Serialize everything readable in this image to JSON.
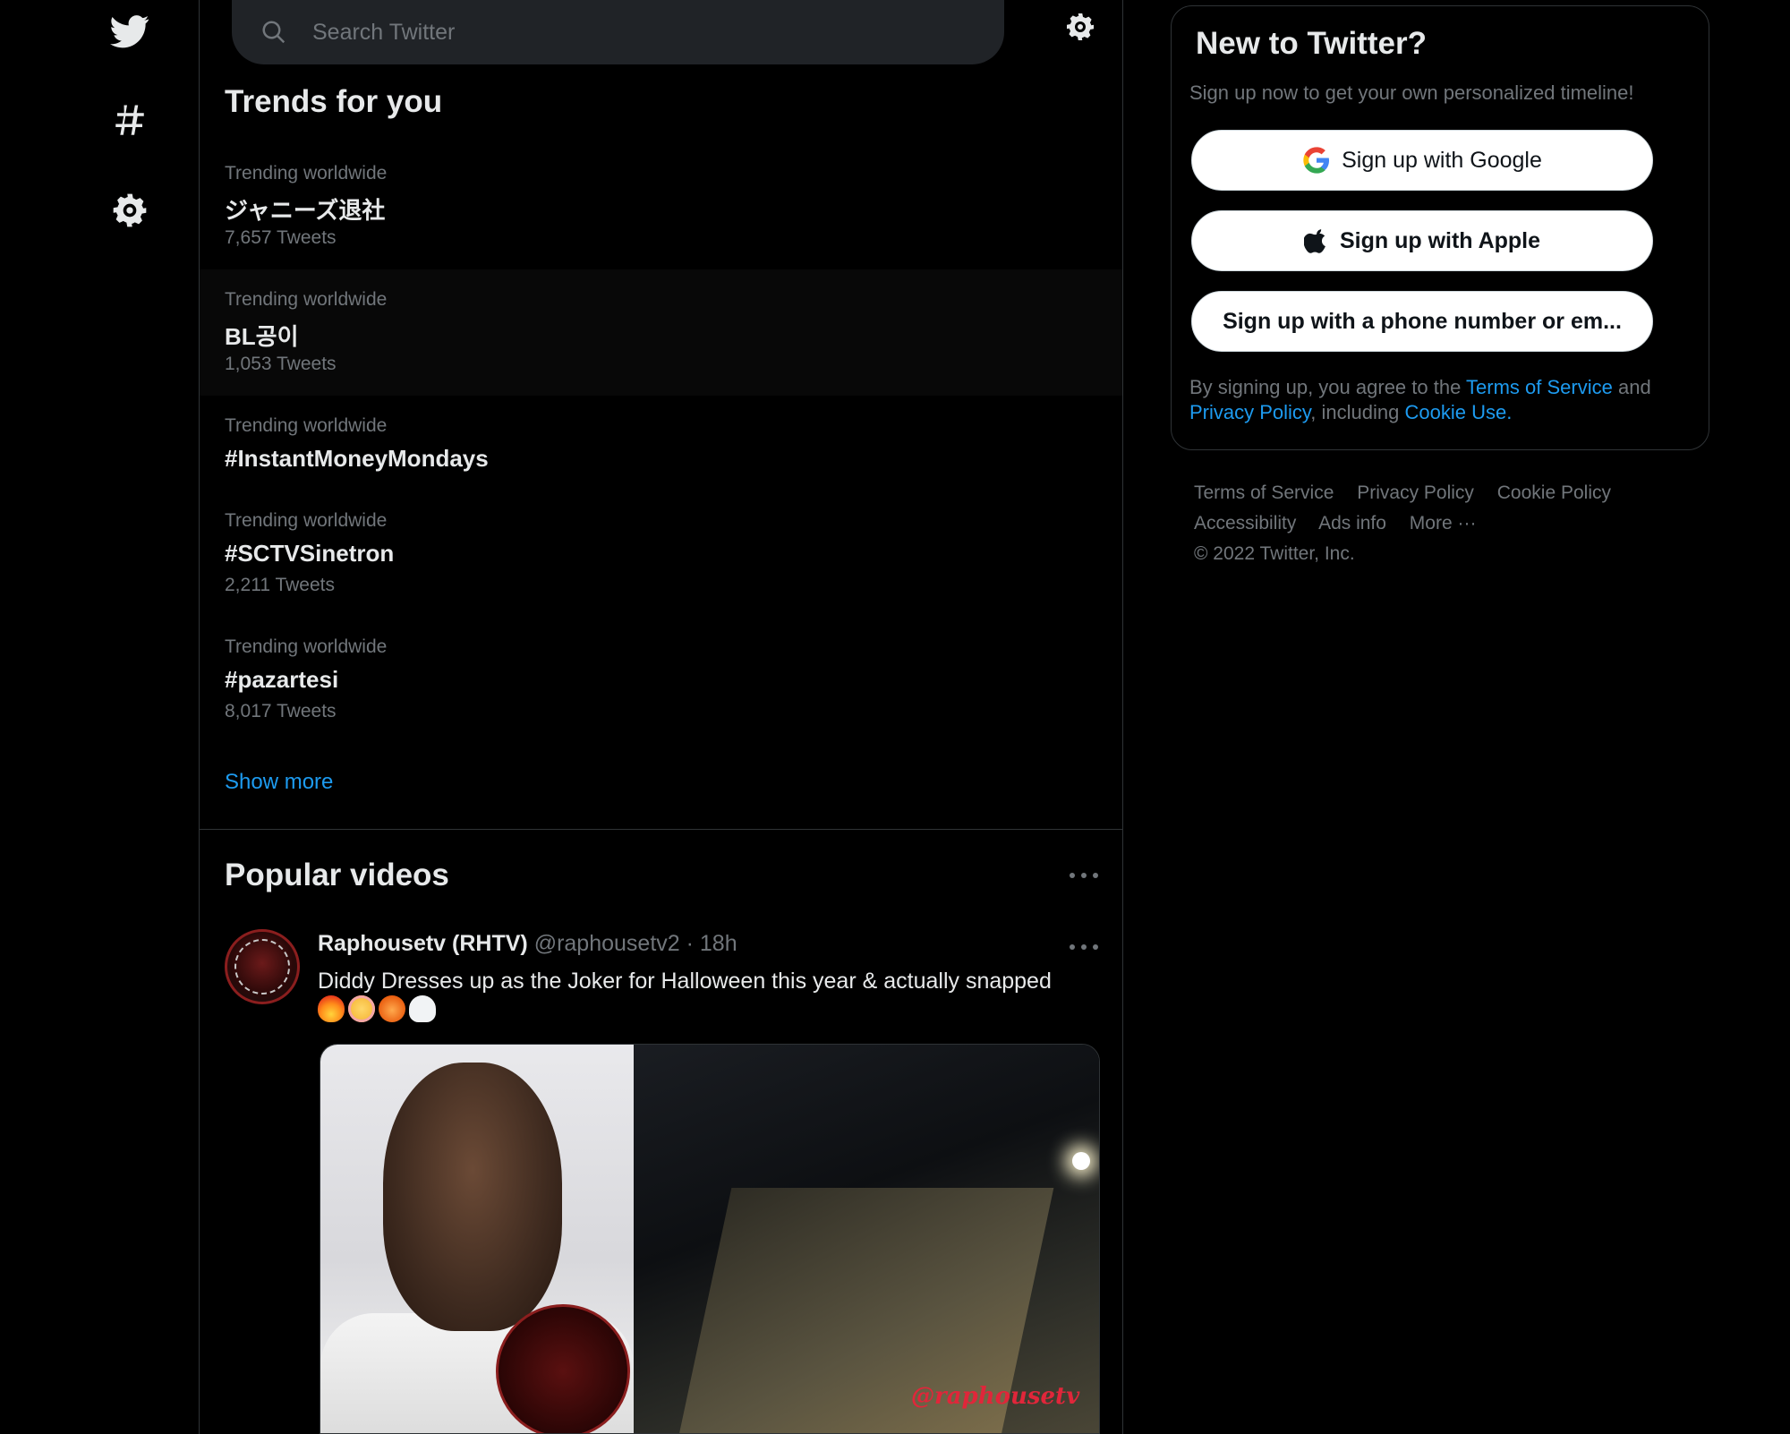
{
  "nav": {
    "items": [
      {
        "icon": "twitter-bird-icon"
      },
      {
        "icon": "hashtag-icon"
      },
      {
        "icon": "gear-icon"
      }
    ]
  },
  "search": {
    "placeholder": "Search Twitter"
  },
  "trends": {
    "title": "Trends for you",
    "items": [
      {
        "meta": "Trending worldwide",
        "name": "ジャニーズ退社",
        "count": "7,657 Tweets"
      },
      {
        "meta": "Trending worldwide",
        "name": "BL공이",
        "count": "1,053 Tweets"
      },
      {
        "meta": "Trending worldwide",
        "name": "#InstantMoneyMondays",
        "count": ""
      },
      {
        "meta": "Trending worldwide",
        "name": "#SCTVSinetron",
        "count": "2,211 Tweets"
      },
      {
        "meta": "Trending worldwide",
        "name": "#pazartesi",
        "count": "8,017 Tweets"
      }
    ],
    "show_more": "Show more"
  },
  "popular_videos": {
    "title": "Popular videos",
    "tweet": {
      "name": "Raphousetv (RHTV)",
      "handle": "@raphousetv2",
      "time": "· 18h",
      "text": "Diddy Dresses up as the Joker for Halloween this year & actually snapped",
      "emojis": [
        "fire",
        "flushed-face",
        "jack-o-lantern",
        "ghost"
      ],
      "media_watermark": "@raphousetv"
    }
  },
  "signup": {
    "title": "New to Twitter?",
    "subtitle": "Sign up now to get your own personalized timeline!",
    "google_label": "Sign up with Google",
    "apple_label": "Sign up with Apple",
    "phone_label": "Sign up with a phone number or em...",
    "legal_prefix": "By signing up, you agree to the",
    "terms_link": "Terms of Service",
    "and_text": "and",
    "privacy_link": "Privacy Policy",
    "including_text": ", including",
    "cookie_link": "Cookie Use."
  },
  "footer": {
    "links_row1": [
      "Terms of Service",
      "Privacy Policy",
      "Cookie Policy"
    ],
    "links_row2": [
      "Accessibility",
      "Ads info",
      "More ···"
    ],
    "copyright": "© 2022 Twitter, Inc."
  },
  "colors": {
    "background": "#000000",
    "accent": "#1d9bf0",
    "text": "#e7e9ea",
    "muted": "#71767b"
  }
}
